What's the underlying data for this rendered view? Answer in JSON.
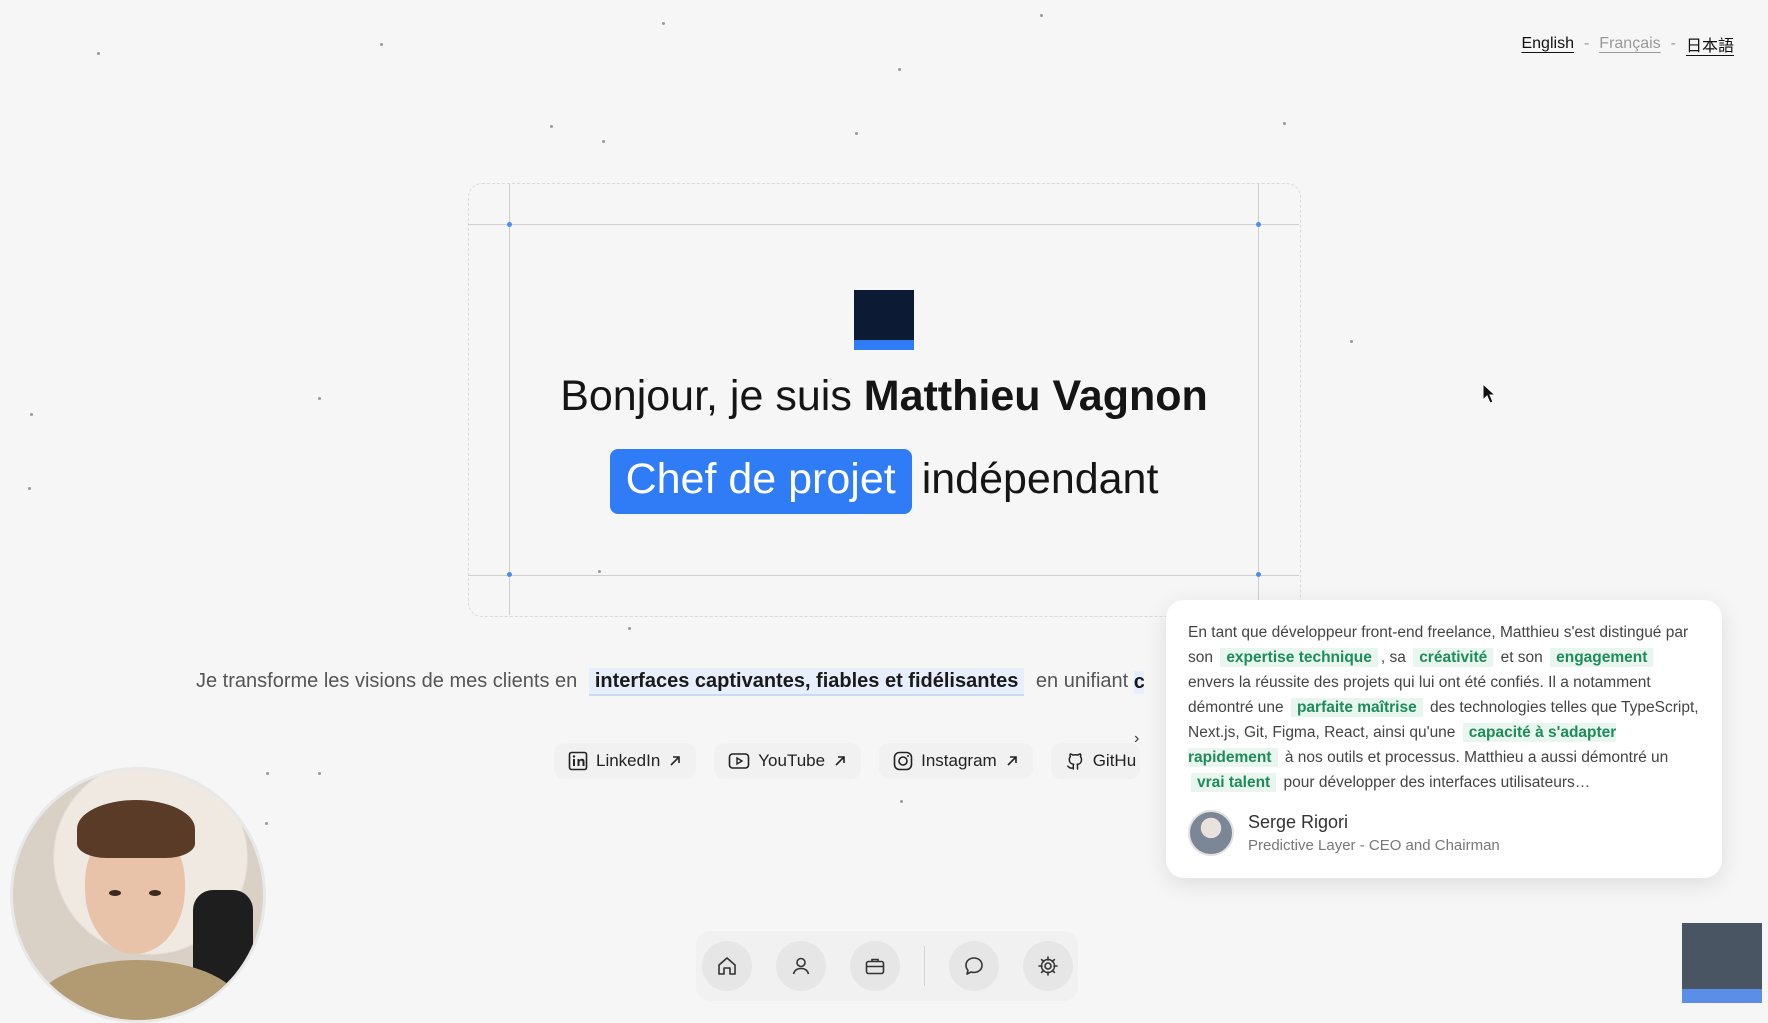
{
  "language_switcher": {
    "items": [
      "English",
      "Français",
      "日本語"
    ],
    "separator": "-"
  },
  "hero": {
    "greeting": "Bonjour, je suis",
    "name": "Matthieu Vagnon",
    "role_highlight": "Chef de projet",
    "role_rest": "indépendant"
  },
  "tagline": {
    "before": "Je transforme les visions de mes clients en",
    "highlight": "interfaces captivantes, fiables et fidélisantes",
    "after": "en unifiant",
    "clipped": "c"
  },
  "socials": [
    {
      "label": "LinkedIn",
      "icon": "linkedin-icon"
    },
    {
      "label": "YouTube",
      "icon": "youtube-icon"
    },
    {
      "label": "Instagram",
      "icon": "instagram-icon"
    },
    {
      "label": "GitHu",
      "icon": "github-icon"
    }
  ],
  "testimonial": {
    "t1": "En tant que développeur front-end freelance, Matthieu s'est distingué par son",
    "k1": "expertise technique",
    "t2": ", sa",
    "k2": "créativité",
    "t3": "et son",
    "k3": "engagement",
    "t4": "envers la réussite des projets qui lui ont été confiés. Il a notamment démontré une",
    "k4": "parfaite maîtrise",
    "t5": "des technologies telles que TypeScript, Next.js, Git, Figma, React, ainsi qu'une",
    "k5": "capacité à s'adapter rapidement",
    "t6": "à nos outils et processus. Matthieu a aussi démontré un",
    "k6": "vrai talent",
    "t7": "pour développer des interfaces utilisateurs…",
    "author_name": "Serge Rigori",
    "author_role": "Predictive Layer - CEO and Chairman"
  },
  "bottom_nav": [
    "home-icon",
    "user-icon",
    "briefcase-icon",
    "chat-icon",
    "settings-icon"
  ],
  "colors": {
    "accent": "#2f7cf6",
    "logo_dark": "#0c1b33",
    "keyword_green": "#1e8c5a",
    "background": "#f6f6f6"
  }
}
